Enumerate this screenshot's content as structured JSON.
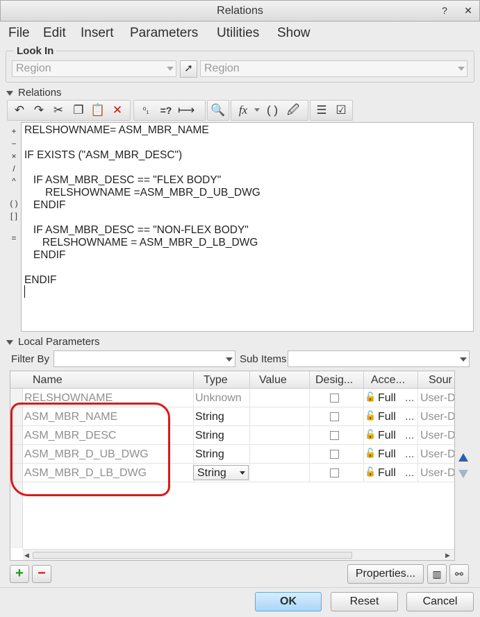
{
  "window": {
    "title": "Relations",
    "help_glyph": "?",
    "close_glyph": "✕"
  },
  "menu": [
    "File",
    "Edit",
    "Insert",
    "Parameters",
    "Utilities",
    "Show"
  ],
  "look_in": {
    "label": "Look In",
    "type_value": "Region",
    "item_value": "Region"
  },
  "relations": {
    "label": "Relations",
    "side_ops": [
      "+",
      "−",
      "×",
      "/",
      "^",
      "( )",
      "[ ]",
      "="
    ],
    "code": [
      "RELSHOWNAME= ASM_MBR_NAME",
      "",
      "IF EXISTS (\"ASM_MBR_DESC\")",
      "",
      "   IF ASM_MBR_DESC == \"FLEX BODY\"",
      "       RELSHOWNAME =ASM_MBR_D_UB_DWG",
      "   ENDIF",
      "",
      "   IF ASM_MBR_DESC == \"NON-FLEX BODY\"",
      "      RELSHOWNAME = ASM_MBR_D_LB_DWG",
      "   ENDIF",
      "",
      "ENDIF"
    ]
  },
  "local_params": {
    "label": "Local Parameters",
    "filter_label": "Filter By",
    "sub_items_label": "Sub Items",
    "columns": [
      "Name",
      "Type",
      "Value",
      "Desig...",
      "Acce...",
      "Sour"
    ],
    "rows": [
      {
        "name": "RELSHOWNAME",
        "type": "Unknown",
        "value": "",
        "access": "Full",
        "source": "User-D"
      },
      {
        "name": "ASM_MBR_NAME",
        "type": "String",
        "value": "",
        "access": "Full",
        "source": "User-D"
      },
      {
        "name": "ASM_MBR_DESC",
        "type": "String",
        "value": "",
        "access": "Full",
        "source": "User-D"
      },
      {
        "name": "ASM_MBR_D_UB_DWG",
        "type": "String",
        "value": "",
        "access": "Full",
        "source": "User-D"
      },
      {
        "name": "ASM_MBR_D_LB_DWG",
        "type": "String",
        "value": "",
        "access": "Full",
        "source": "User-D"
      }
    ],
    "ellipsis": "...",
    "properties_label": "Properties...",
    "add_glyph": "+",
    "remove_glyph": "−"
  },
  "footer": {
    "ok": "OK",
    "reset": "Reset",
    "cancel": "Cancel"
  },
  "colors": {
    "annotation": "#e01616",
    "accent": "#2d5fa8",
    "ok_bg": "#a9d6f7"
  }
}
